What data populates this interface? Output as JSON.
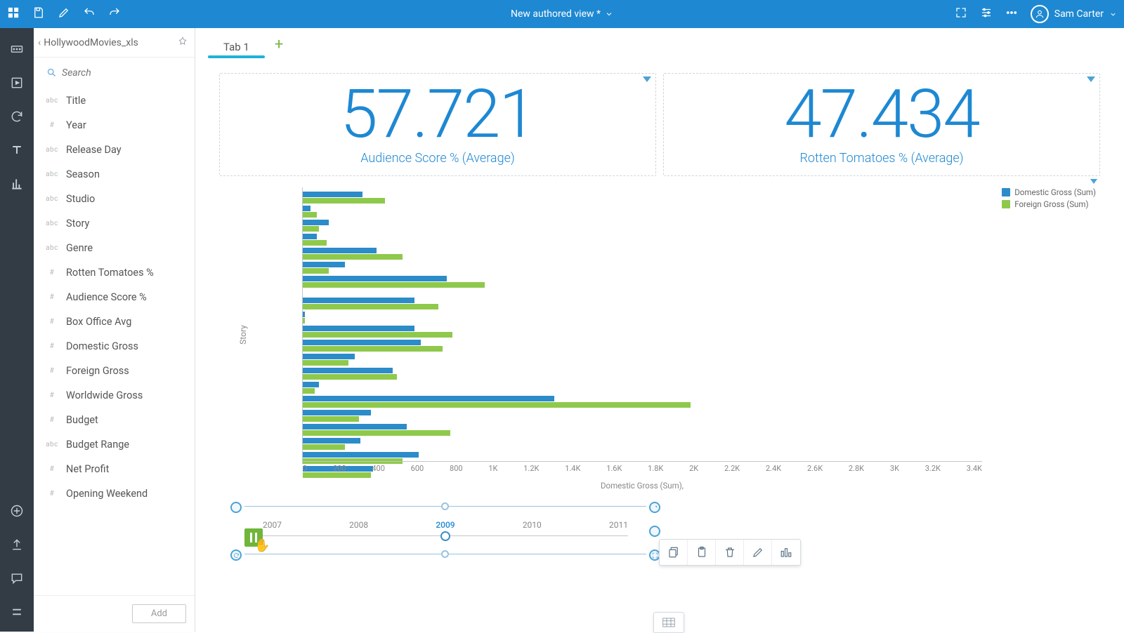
{
  "header": {
    "title": "New authored view *",
    "user": "Sam Carter"
  },
  "fields_panel": {
    "dataset": "HollywoodMovies_xls",
    "search_placeholder": "Search",
    "add_label": "Add",
    "fields": [
      {
        "type": "abc",
        "name": "Title"
      },
      {
        "type": "#",
        "name": "Year"
      },
      {
        "type": "abc",
        "name": "Release Day"
      },
      {
        "type": "abc",
        "name": "Season"
      },
      {
        "type": "abc",
        "name": "Studio"
      },
      {
        "type": "abc",
        "name": "Story"
      },
      {
        "type": "abc",
        "name": "Genre"
      },
      {
        "type": "#",
        "name": "Rotten Tomatoes %"
      },
      {
        "type": "#",
        "name": "Audience Score %"
      },
      {
        "type": "#",
        "name": "Box Office Avg"
      },
      {
        "type": "#",
        "name": "Domestic Gross"
      },
      {
        "type": "#",
        "name": "Foreign Gross"
      },
      {
        "type": "#",
        "name": "Worldwide Gross"
      },
      {
        "type": "#",
        "name": "Budget"
      },
      {
        "type": "abc",
        "name": "Budget Range"
      },
      {
        "type": "#",
        "name": "Net Profit"
      },
      {
        "type": "#",
        "name": "Opening Weekend"
      }
    ]
  },
  "tabs": {
    "active": "Tab 1"
  },
  "kpis": [
    {
      "value": "57.721",
      "label": "Audience Score % (Average)"
    },
    {
      "value": "47.434",
      "label": "Rotten Tomatoes % (Average)"
    }
  ],
  "legend": [
    {
      "color": "c-blue",
      "label": "Domestic Gross (Sum)"
    },
    {
      "color": "c-green",
      "label": "Foreign Gross (Sum)"
    }
  ],
  "chart_data": {
    "type": "bar",
    "orientation": "horizontal",
    "ylabel": "Story",
    "xlabel": "Domestic Gross (Sum),",
    "xticks": [
      "0",
      "200",
      "400",
      "600",
      "800",
      "1K",
      "1.2K",
      "1.4K",
      "1.6K",
      "1.8K",
      "2K",
      "2.2K",
      "2.4K",
      "2.6K",
      "2.8K",
      "3K",
      "3.2K",
      "3.4K"
    ],
    "xlim": [
      0,
      3400
    ],
    "series_names": [
      "Domestic Gross (Sum)",
      "Foreign Gross (Sum)"
    ],
    "colors": [
      "#2c8cc9",
      "#8fc94c"
    ],
    "rows": [
      {
        "domestic": 300,
        "foreign": 410
      },
      {
        "domestic": 40,
        "foreign": 70
      },
      {
        "domestic": 130,
        "foreign": 80
      },
      {
        "domestic": 70,
        "foreign": 120
      },
      {
        "domestic": 370,
        "foreign": 500
      },
      {
        "domestic": 210,
        "foreign": 130
      },
      {
        "domestic": 720,
        "foreign": 910
      },
      {
        "domestic": 560,
        "foreign": 680
      },
      {
        "domestic": 10,
        "foreign": 10
      },
      {
        "domestic": 560,
        "foreign": 750
      },
      {
        "domestic": 590,
        "foreign": 700
      },
      {
        "domestic": 260,
        "foreign": 230
      },
      {
        "domestic": 450,
        "foreign": 470
      },
      {
        "domestic": 80,
        "foreign": 60
      },
      {
        "domestic": 1260,
        "foreign": 1940
      },
      {
        "domestic": 340,
        "foreign": 280
      },
      {
        "domestic": 520,
        "foreign": 740
      },
      {
        "domestic": 290,
        "foreign": 210
      },
      {
        "domestic": 580,
        "foreign": 500
      },
      {
        "domestic": 350,
        "foreign": 340
      }
    ]
  },
  "timeline": {
    "years": [
      "2007",
      "2008",
      "2009",
      "2010",
      "2011"
    ],
    "selected": "2009"
  }
}
